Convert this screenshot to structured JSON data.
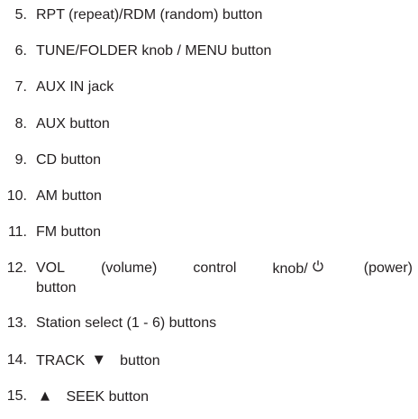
{
  "items": [
    {
      "num": "5.",
      "text": "RPT (repeat)/RDM (random) button"
    },
    {
      "num": "6.",
      "text": "TUNE/FOLDER knob / MENU button"
    },
    {
      "num": "7.",
      "text": "AUX IN jack"
    },
    {
      "num": "8.",
      "text": "AUX button"
    },
    {
      "num": "9.",
      "text": "CD button"
    },
    {
      "num": "10.",
      "text": "AM button"
    },
    {
      "num": "11.",
      "text": "FM button"
    },
    {
      "num": "12.",
      "w1": "VOL",
      "w2": "(volume)",
      "w3": "control",
      "w4": "knob/",
      "w5": "(power)",
      "line2": "button"
    },
    {
      "num": "13.",
      "text": "Station select (1 - 6) buttons"
    },
    {
      "num": "14.",
      "pre": "TRACK",
      "post": "button"
    },
    {
      "num": "15.",
      "post": "SEEK button"
    }
  ],
  "icons": {
    "power": "power-icon",
    "track_down": "triangle-down-icon",
    "seek_up": "triangle-up-icon"
  }
}
